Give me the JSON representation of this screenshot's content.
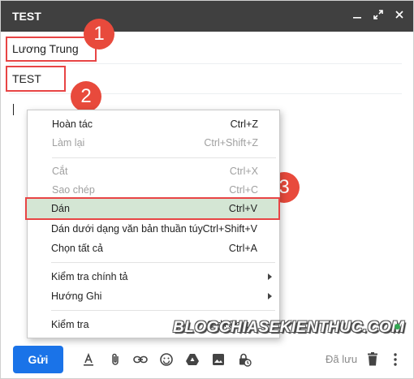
{
  "window": {
    "title": "TEST",
    "minimize_icon": "minimize-icon",
    "expand_icon": "expand-icon",
    "close_icon": "close-icon"
  },
  "compose": {
    "to_value": "Lương Trung",
    "subject_value": "TEST"
  },
  "badges": [
    "1",
    "2",
    "3"
  ],
  "context_menu": {
    "items": [
      {
        "label": "Hoàn tác",
        "shortcut": "Ctrl+Z",
        "disabled": false
      },
      {
        "label": "Làm lại",
        "shortcut": "Ctrl+Shift+Z",
        "disabled": true
      },
      {
        "label": "Cắt",
        "shortcut": "Ctrl+X",
        "disabled": true
      },
      {
        "label": "Sao chép",
        "shortcut": "Ctrl+C",
        "disabled": true
      },
      {
        "label": "Dán",
        "shortcut": "Ctrl+V",
        "disabled": false,
        "highlighted": true
      },
      {
        "label": "Dán dưới dạng văn bản thuần túy",
        "shortcut": "Ctrl+Shift+V",
        "disabled": false
      },
      {
        "label": "Chọn tất cả",
        "shortcut": "Ctrl+A",
        "disabled": false
      },
      {
        "label": "Kiểm tra chính tả",
        "shortcut": "",
        "submenu": true
      },
      {
        "label": "Hướng Ghi",
        "shortcut": "",
        "submenu": true
      },
      {
        "label": "Kiểm tra",
        "shortcut": "Ctrl+Shift+I",
        "disabled": false
      }
    ]
  },
  "watermark": "BLOGCHIASEKIENTHUC.COM",
  "toolbar": {
    "send_label": "Gửi",
    "saved_label": "Đã lưu"
  },
  "colors": {
    "titlebar": "#404040",
    "send": "#1a73e8",
    "highlight_box": "#e84545",
    "badge": "#e84a3c",
    "paste_bg": "#d4e6d4",
    "online_dot": "#34a853"
  }
}
